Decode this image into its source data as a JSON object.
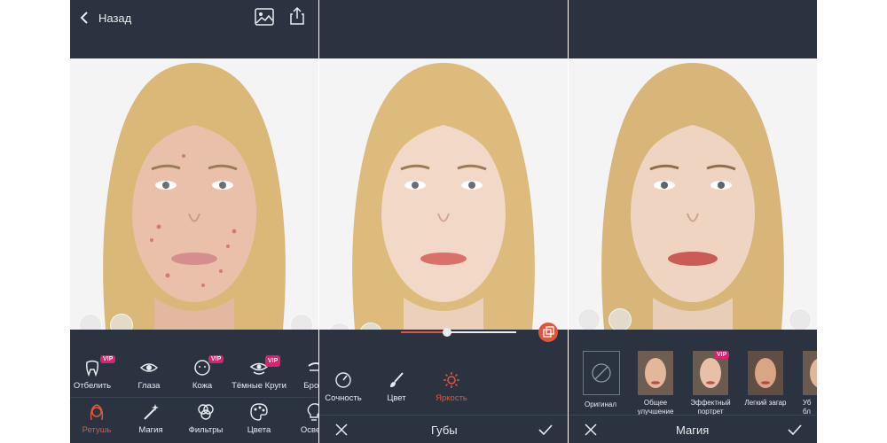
{
  "header": {
    "back_label": "Назад"
  },
  "panel1": {
    "tools": [
      {
        "label": "Отбелить",
        "vip": "VIP"
      },
      {
        "label": "Глаза"
      },
      {
        "label": "Кожа",
        "vip": "VIP"
      },
      {
        "label": "Тёмные Круги",
        "vip": "VIP"
      },
      {
        "label": "Брови"
      }
    ],
    "categories": [
      {
        "label": "Ретушь",
        "active": true
      },
      {
        "label": "Магия"
      },
      {
        "label": "Фильтры"
      },
      {
        "label": "Цвета"
      },
      {
        "label": "Освещ"
      }
    ]
  },
  "panel2": {
    "slider_value": 0.4,
    "options": [
      {
        "label": "Сочность"
      },
      {
        "label": "Цвет"
      },
      {
        "label": "Яркость",
        "active": true
      }
    ],
    "bar_title": "Губы"
  },
  "panel3": {
    "presets": [
      {
        "label": "Оригинал"
      },
      {
        "label": "Общее улучшение"
      },
      {
        "label": "Эффектный портрет",
        "vip": "VIP"
      },
      {
        "label": "Легкий загар"
      },
      {
        "label": "Уб бл"
      }
    ],
    "bar_title": "Магия"
  },
  "colors": {
    "panel_bg": "#2b3340",
    "accent": "#e0563c",
    "vip": "#d6246e"
  }
}
